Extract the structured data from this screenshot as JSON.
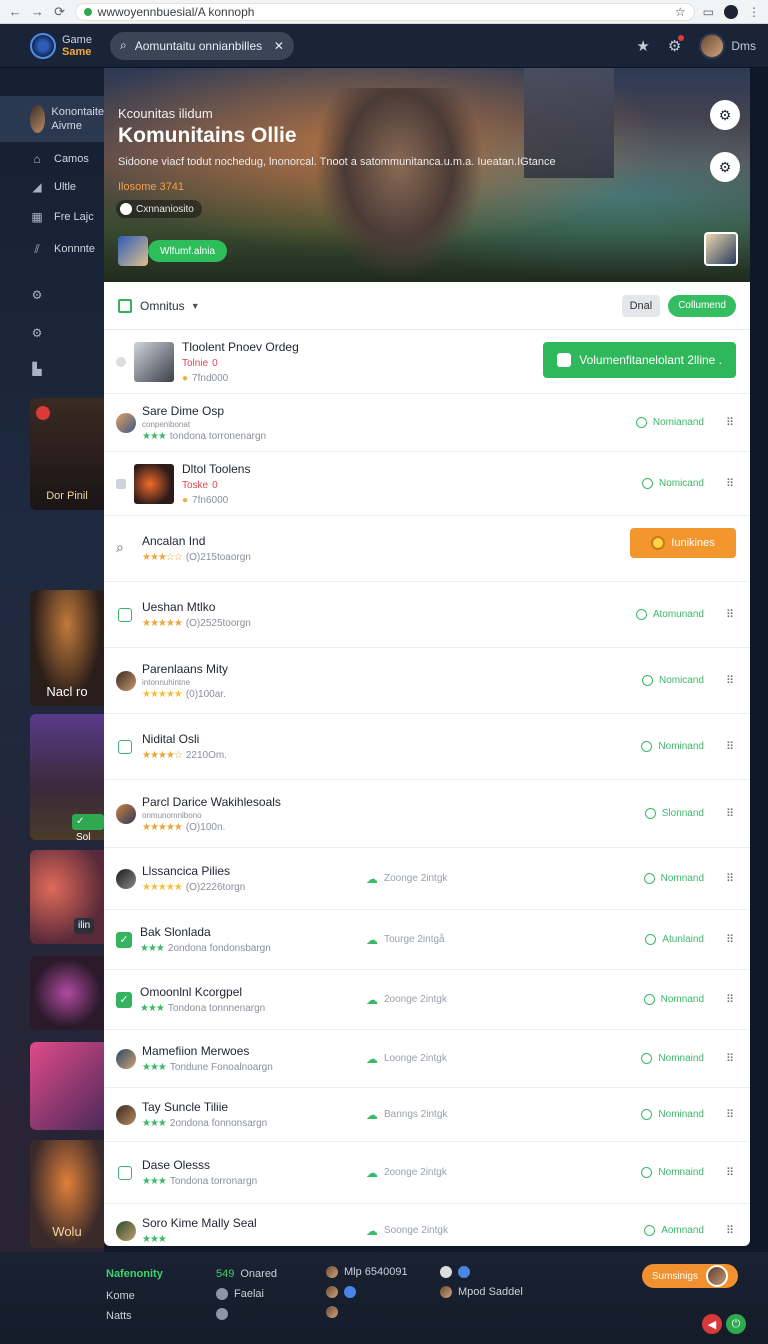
{
  "browser": {
    "url": "wwwoyennbuesial/A konnoph"
  },
  "header": {
    "brand_line1": "Game",
    "brand_line2": "Same",
    "search_value": "Aomuntaitu onnianbilles",
    "user_label": "Dms"
  },
  "sidebar": {
    "profile_name_1": "Konontaite",
    "profile_name_2": "Aivme",
    "items": [
      {
        "label": "Camos",
        "icon": "home-icon"
      },
      {
        "label": "Ultle",
        "icon": "chart-icon"
      },
      {
        "label": "Fre Lajc",
        "icon": "grid-icon"
      },
      {
        "label": "Konnnte",
        "icon": "slash-icon"
      }
    ],
    "cards": [
      {
        "caption": "Dor Pinil"
      },
      {
        "caption": "Nacl ro"
      },
      {
        "caption": "✓ Sol"
      },
      {
        "caption": "ilin"
      },
      {
        "caption": ""
      },
      {
        "caption": ""
      },
      {
        "caption": "Wolu"
      }
    ]
  },
  "hero": {
    "kicker": "Kcounitas ilidum",
    "title": "Komunitains Ollie",
    "description": "Sidoone viacf todut nochedug, lnonorcal. Tnoot a satommunitanca.u.m.a. Iueatan.IGtance",
    "stat": "Ilosome 3741",
    "chip": "Cxnnaniosito",
    "join_button": "Wlfumf.alnia"
  },
  "filter": {
    "label": "Omnitus",
    "gray_button": "Dnal",
    "green_button": "Collumend"
  },
  "banner_text": "Volumenfitanelolant 2lline .",
  "orange_button": "Iunikines",
  "rows": [
    {
      "name": "Tloolent Pnoev Ordeg",
      "sub1": "Tolnie",
      "sub2": "0",
      "sub3": "7fnd000",
      "status": ""
    },
    {
      "name": "Sare Dime Osp",
      "sub_small": "conpenibonat",
      "sub": "tondona torronenargn",
      "status": "Nomianand"
    },
    {
      "name": "Dltol Toolens",
      "sub1": "Toske",
      "sub2": "0",
      "sub3": "7fn6000",
      "status": "Nomicand"
    },
    {
      "name": "Ancalan Ind",
      "sub": "(O)215toaorgn",
      "status": ""
    },
    {
      "name": "Ueshan Mtlko",
      "sub": "(O)2525toorgn",
      "status": "Atomunand"
    },
    {
      "name": "Parenlaans Mity",
      "sub_small": "intonnuhintne",
      "sub": "(0)100ar.",
      "status": "Nomicand"
    },
    {
      "name": "Nidital Osli",
      "sub": "2210Om.",
      "status": "Nominand"
    },
    {
      "name": "Parcl Darice Wakihlesoals",
      "sub_small": "onmunomnlbono",
      "sub": "(O)100n.",
      "status": "Slonnand"
    },
    {
      "name": "Llssancica Pilies",
      "sub": "(O)2226torgn",
      "mid": "Zoonge 2intgk",
      "status": "Nomnand"
    },
    {
      "name": "Bak Slonlada",
      "sub": "2ondona fondonsbargn",
      "mid": "Tourge 2intgå",
      "status": "Atunlaind"
    },
    {
      "name": "Omoonlnl Kcorgpel",
      "sub": "Tondona tonnnenargn",
      "mid": "2oonge 2intgk",
      "status": "Nomnand"
    },
    {
      "name": "Mamefiion Merwoes",
      "sub": "Tondune Fonoalnoargn",
      "mid": "Loonge 2intgk",
      "status": "Nomnaind"
    },
    {
      "name": "Tay Suncle Tiliie",
      "sub": "2ondona fonnonsargn",
      "mid": "Banngs 2intgk",
      "status": "Nominand"
    },
    {
      "name": "Dase Olesss",
      "sub": "Tondona torronargn",
      "mid": "2oonge 2intgk",
      "status": "Nomnaind"
    },
    {
      "name": "Soro Kime Mally Seal",
      "sub": "",
      "mid": "Soonge 2intgk",
      "status": "Aomnand"
    }
  ],
  "footer": {
    "col1": [
      "Nafenonity",
      "Kome",
      "Natts"
    ],
    "col2_label": "Onared",
    "col2_value": "549",
    "col2_row2": "Faelai",
    "col3_row1": "Mlp 6540091",
    "col4_row2": "Mpod Saddel",
    "summary_button": "Sumsinigs"
  },
  "colors": {
    "accent_green": "#35bd62",
    "accent_orange": "#f3962d",
    "header_bg": "#1a2438"
  }
}
